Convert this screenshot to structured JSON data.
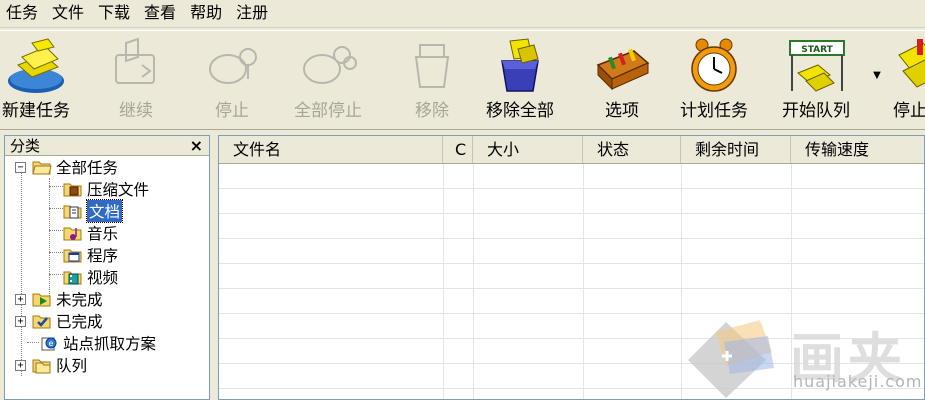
{
  "menu": [
    "任务",
    "文件",
    "下载",
    "查看",
    "帮助",
    "注册"
  ],
  "toolbar": {
    "buttons": [
      {
        "label": "新建任务",
        "icon": "new-task-icon",
        "enabled": true
      },
      {
        "label": "继续",
        "icon": "resume-icon",
        "enabled": false
      },
      {
        "label": "停止",
        "icon": "stop-icon",
        "enabled": false
      },
      {
        "label": "全部停止",
        "icon": "stop-all-icon",
        "enabled": false
      },
      {
        "label": "移除",
        "icon": "remove-icon",
        "enabled": false
      },
      {
        "label": "移除全部",
        "icon": "remove-all-icon",
        "enabled": true
      },
      {
        "label": "选项",
        "icon": "options-icon",
        "enabled": true
      },
      {
        "label": "计划任务",
        "icon": "schedule-icon",
        "enabled": true
      },
      {
        "label": "开始队列",
        "icon": "start-queue-icon",
        "enabled": true,
        "badge": "START"
      },
      {
        "label": "停止",
        "icon": "stop-queue-icon",
        "enabled": true
      }
    ]
  },
  "sidebar": {
    "title": "分类",
    "close": "×",
    "tree": [
      {
        "label": "全部任务",
        "icon": "folder-open-icon",
        "expander": "−"
      },
      {
        "label": "压缩文件",
        "icon": "archive-icon"
      },
      {
        "label": "文档",
        "icon": "document-icon",
        "selected": true
      },
      {
        "label": "音乐",
        "icon": "music-icon"
      },
      {
        "label": "程序",
        "icon": "program-icon"
      },
      {
        "label": "视频",
        "icon": "video-icon"
      },
      {
        "label": "未完成",
        "icon": "incomplete-folder-icon",
        "expander": "+"
      },
      {
        "label": "已完成",
        "icon": "complete-folder-icon",
        "expander": "+"
      },
      {
        "label": "站点抓取方案",
        "icon": "site-grab-icon"
      },
      {
        "label": "队列",
        "icon": "queue-folder-icon",
        "expander": "+"
      }
    ]
  },
  "list": {
    "columns": [
      "文件名",
      "C",
      "大小",
      "状态",
      "剩余时间",
      "传输速度"
    ]
  },
  "watermark": {
    "text": "画夹",
    "url": "huajiakeji.com"
  },
  "colors": {
    "selection": "#316ac5",
    "chrome": "#ece9d8",
    "border": "#7f9db9"
  }
}
